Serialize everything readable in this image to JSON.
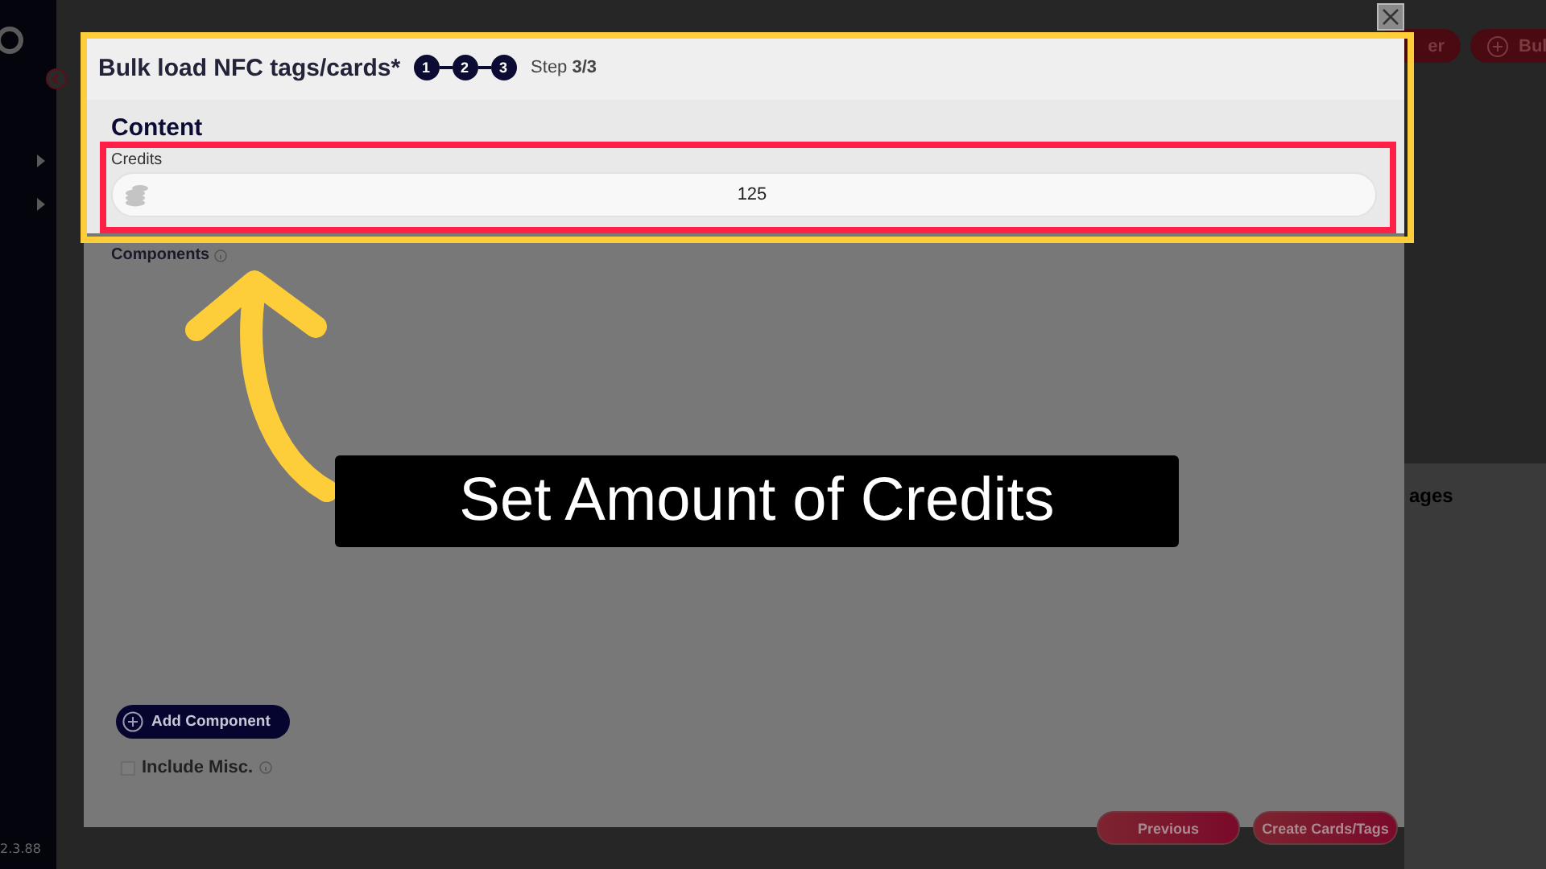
{
  "background": {
    "header_buttons": [
      {
        "label": "er",
        "kind": "plain"
      },
      {
        "label": "Bul",
        "kind": "add"
      }
    ],
    "panel_heading": "ages",
    "version": "2.3.88"
  },
  "dialog": {
    "title": "Bulk load NFC tags/cards*",
    "steps": [
      "1",
      "2",
      "3"
    ],
    "step_text": "Step **3/3**",
    "section": "Content",
    "credits": {
      "label": "Credits",
      "value": "125"
    },
    "components_label": "Components",
    "add_button": "Add Component",
    "include_misc": {
      "label": "Include Misc.",
      "checked": false
    },
    "buttons": [
      "Previous",
      "Create Cards/Tags"
    ]
  },
  "annotation": {
    "caption": "Set Amount of Credits"
  }
}
